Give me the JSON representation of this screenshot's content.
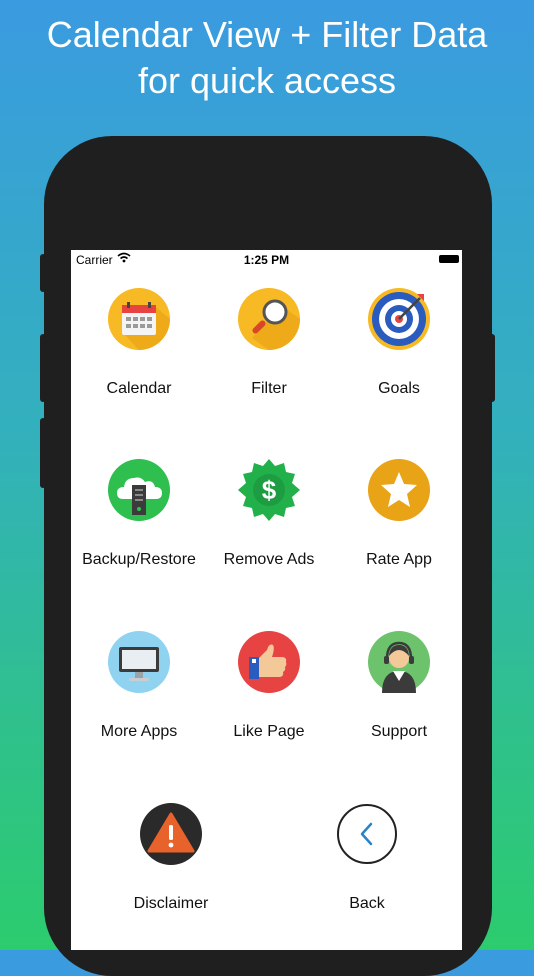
{
  "promo": {
    "line1": "Calendar View + Filter Data",
    "line2": "for quick access"
  },
  "status_bar": {
    "carrier": "Carrier",
    "time": "1:25 PM"
  },
  "menu": {
    "calendar": "Calendar",
    "filter": "Filter",
    "goals": "Goals",
    "backup": "Backup/Restore",
    "remove_ads": "Remove Ads",
    "rate": "Rate App",
    "more_apps": "More Apps",
    "like": "Like Page",
    "support": "Support",
    "disclaimer": "Disclaimer",
    "back": "Back"
  },
  "icons": {
    "calendar": "calendar-icon",
    "filter": "magnifier-icon",
    "goals": "target-icon",
    "backup": "cloud-server-icon",
    "remove_ads": "dollar-badge-icon",
    "rate": "star-icon",
    "more_apps": "monitor-icon",
    "like": "thumbs-up-icon",
    "support": "headset-agent-icon",
    "disclaimer": "warning-icon",
    "back": "chevron-left-icon"
  },
  "colors": {
    "calendar_bg": "#f7b924",
    "filter_bg": "#f7b924",
    "goals_bg": "#f7b924",
    "backup_bg": "#2fbf4f",
    "remove_ads_bg": "#2fbf4f",
    "rate_bg": "#e8a317",
    "more_apps_bg": "#8fd3f0",
    "like_bg": "#e84343",
    "support_bg": "#6cc36c",
    "disclaimer_bg": "#2a2a2a",
    "back_accent": "#2a83c7"
  }
}
